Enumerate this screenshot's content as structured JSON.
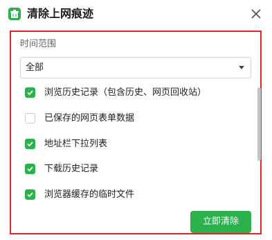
{
  "dialog": {
    "title": "清除上网痕迹",
    "icon": "broom-icon",
    "close_icon": "close-icon"
  },
  "time_range": {
    "label": "时间范围",
    "selected": "全部"
  },
  "options": [
    {
      "label": "浏览历史记录（包含历史、网页回收站）",
      "checked": true
    },
    {
      "label": "已保存的网页表单数据",
      "checked": false
    },
    {
      "label": "地址栏下拉列表",
      "checked": true
    },
    {
      "label": "下载历史记录",
      "checked": true
    },
    {
      "label": "浏览器缓存的临时文件",
      "checked": true
    }
  ],
  "actions": {
    "clear_now": "立即清除"
  },
  "colors": {
    "accent": "#2bb24c",
    "highlight_frame": "#e02424"
  }
}
